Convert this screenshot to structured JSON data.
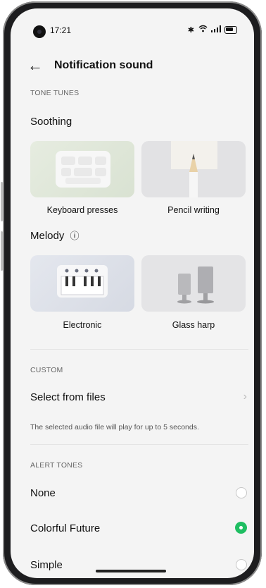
{
  "status_bar": {
    "time": "17:21",
    "icons": [
      "bluetooth-icon",
      "wifi-icon",
      "signal-icon",
      "battery-icon"
    ]
  },
  "header": {
    "back_icon": "←",
    "title": "Notification sound"
  },
  "tone_tunes": {
    "section_label": "TONE TUNES",
    "soothing": {
      "label": "Soothing",
      "cards": [
        {
          "caption": "Keyboard presses"
        },
        {
          "caption": "Pencil writing"
        }
      ]
    },
    "melody": {
      "label": "Melody",
      "info_icon": "ⓘ",
      "cards": [
        {
          "caption": "Electronic"
        },
        {
          "caption": "Glass harp"
        }
      ]
    }
  },
  "custom": {
    "section_label": "CUSTOM",
    "select_label": "Select from files",
    "chevron": "›",
    "hint": "The selected audio file will play for up to 5 seconds."
  },
  "alert_tones": {
    "section_label": "ALERT TONES",
    "items": [
      {
        "label": "None",
        "selected": false
      },
      {
        "label": "Colorful Future",
        "selected": true
      },
      {
        "label": "Simple",
        "selected": false
      }
    ]
  },
  "colors": {
    "accent": "#1fbe62",
    "background": "#f4f4f4"
  }
}
